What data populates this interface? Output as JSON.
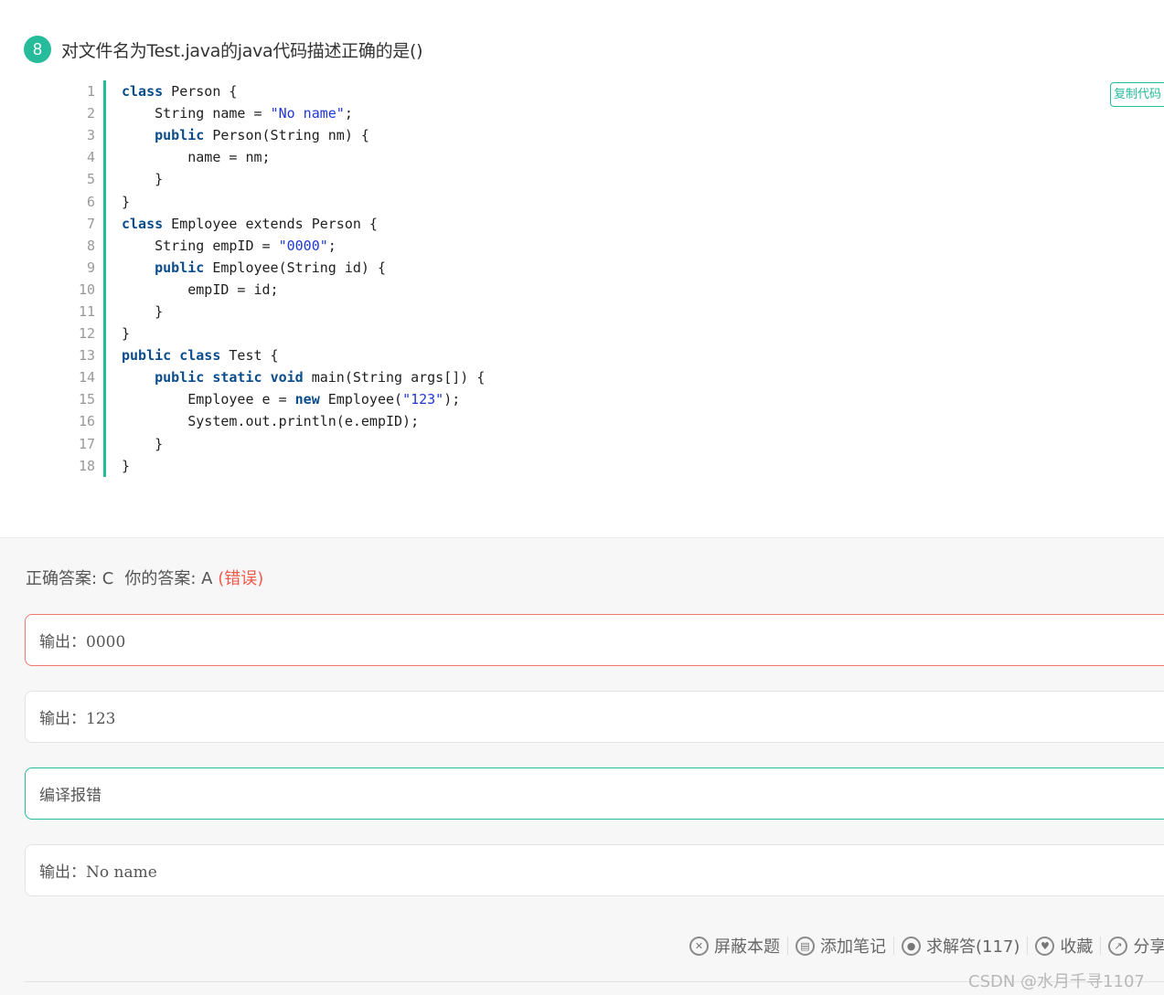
{
  "question": {
    "number": "8",
    "title": "对文件名为Test.java的java代码描述正确的是()",
    "copy_button": "复制代码"
  },
  "code_lines": [
    {
      "n": "1",
      "tokens": [
        [
          "kw",
          "class"
        ],
        [
          "t",
          " Person {"
        ]
      ]
    },
    {
      "n": "2",
      "tokens": [
        [
          "t",
          "    String name = "
        ],
        [
          "str",
          "\"No name\""
        ],
        [
          "t",
          ";"
        ]
      ]
    },
    {
      "n": "3",
      "tokens": [
        [
          "t",
          "    "
        ],
        [
          "kw",
          "public"
        ],
        [
          "t",
          " Person(String nm) {"
        ]
      ]
    },
    {
      "n": "4",
      "tokens": [
        [
          "t",
          "        name = nm;"
        ]
      ]
    },
    {
      "n": "5",
      "tokens": [
        [
          "t",
          "    }"
        ]
      ]
    },
    {
      "n": "6",
      "tokens": [
        [
          "t",
          "}"
        ]
      ]
    },
    {
      "n": "7",
      "tokens": [
        [
          "kw",
          "class"
        ],
        [
          "t",
          " Employee extends Person {"
        ]
      ]
    },
    {
      "n": "8",
      "tokens": [
        [
          "t",
          "    String empID = "
        ],
        [
          "str",
          "\"0000\""
        ],
        [
          "t",
          ";"
        ]
      ]
    },
    {
      "n": "9",
      "tokens": [
        [
          "t",
          "    "
        ],
        [
          "kw",
          "public"
        ],
        [
          "t",
          " Employee(String id) {"
        ]
      ]
    },
    {
      "n": "10",
      "tokens": [
        [
          "t",
          "        empID = id;"
        ]
      ]
    },
    {
      "n": "11",
      "tokens": [
        [
          "t",
          "    }"
        ]
      ]
    },
    {
      "n": "12",
      "tokens": [
        [
          "t",
          "}"
        ]
      ]
    },
    {
      "n": "13",
      "tokens": [
        [
          "kw",
          "public"
        ],
        [
          "t",
          " "
        ],
        [
          "kw",
          "class"
        ],
        [
          "t",
          " Test {"
        ]
      ]
    },
    {
      "n": "14",
      "tokens": [
        [
          "t",
          "    "
        ],
        [
          "kw",
          "public"
        ],
        [
          "t",
          " "
        ],
        [
          "kw",
          "static"
        ],
        [
          "t",
          " "
        ],
        [
          "kw",
          "void"
        ],
        [
          "t",
          " main(String args[]) {"
        ]
      ]
    },
    {
      "n": "15",
      "tokens": [
        [
          "t",
          "        Employee e = "
        ],
        [
          "kw",
          "new"
        ],
        [
          "t",
          " Employee("
        ],
        [
          "str",
          "\"123\""
        ],
        [
          "t",
          ");"
        ]
      ]
    },
    {
      "n": "16",
      "tokens": [
        [
          "t",
          "        System.out.println(e.empID);"
        ]
      ]
    },
    {
      "n": "17",
      "tokens": [
        [
          "t",
          "    }"
        ]
      ]
    },
    {
      "n": "18",
      "tokens": [
        [
          "t",
          "}"
        ]
      ]
    }
  ],
  "answer": {
    "correct_label": "正确答案: C",
    "yours_label": "你的答案: A",
    "result": "(错误)"
  },
  "options": [
    {
      "text": "输出：0000",
      "state": "selected-wrong"
    },
    {
      "text": "输出：123",
      "state": "normal"
    },
    {
      "text": "编译报错",
      "state": "correct"
    },
    {
      "text": "输出：No name",
      "state": "normal"
    }
  ],
  "toolbar": {
    "hide": "屏蔽本题",
    "note": "添加笔记",
    "ask": "求解答(117)",
    "favorite": "收藏",
    "share": "分享"
  },
  "watermark": "CSDN @水月千寻1107",
  "colors": {
    "accent": "#25bb9b",
    "wrong": "#f05a4c",
    "keyword": "#0b4c8c",
    "string": "#1e38d6"
  }
}
